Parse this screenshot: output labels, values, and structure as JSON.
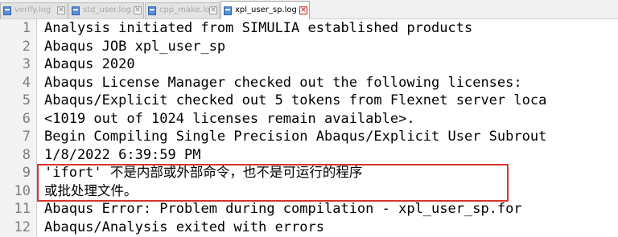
{
  "tabs": [
    {
      "label": "verify.log",
      "close": "✕"
    },
    {
      "label": "std_user.log",
      "close": "✕"
    },
    {
      "label": "cpp_make.log",
      "close": "✕"
    },
    {
      "label": "xpl_user_sp.log",
      "close": "✕"
    }
  ],
  "lines": [
    {
      "num": "1",
      "text": "Analysis initiated from SIMULIA established products"
    },
    {
      "num": "2",
      "text": "Abaqus JOB xpl_user_sp"
    },
    {
      "num": "3",
      "text": "Abaqus 2020"
    },
    {
      "num": "4",
      "text": "Abaqus License Manager checked out the following licenses:"
    },
    {
      "num": "5",
      "text": "Abaqus/Explicit checked out 5 tokens from Flexnet server loca"
    },
    {
      "num": "6",
      "text": "<1019 out of 1024 licenses remain available>."
    },
    {
      "num": "7",
      "text": "Begin Compiling Single Precision Abaqus/Explicit User Subrout"
    },
    {
      "num": "8",
      "text": "1/8/2022 6:39:59 PM"
    },
    {
      "num": "9",
      "text_prefix": "'ifort' ",
      "text": "不是内部或外部命令，也不是可运行的程序"
    },
    {
      "num": "10",
      "text": "或批处理文件。"
    },
    {
      "num": "11",
      "text": "Abaqus Error: Problem during compilation - xpl_user_sp.for"
    },
    {
      "num": "12",
      "text": "Abaqus/Analysis exited with errors"
    }
  ],
  "colors": {
    "highlight_border": "#d9332a",
    "active_tab_close": "#cc2222"
  }
}
